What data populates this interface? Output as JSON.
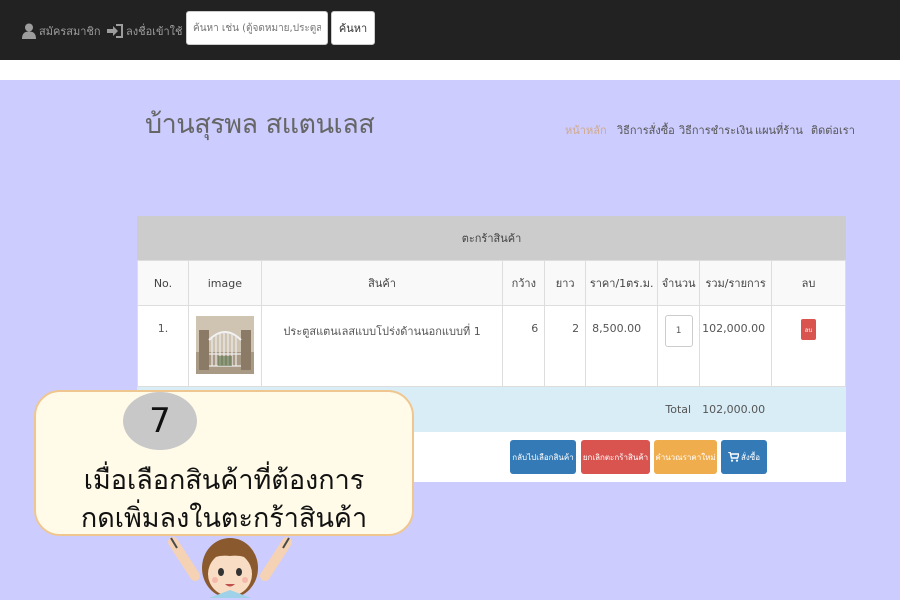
{
  "topbar": {
    "register_label": "สมัครสมาชิก",
    "login_label": "ลงชื่อเข้าใช้",
    "search_placeholder": "ค้นหา เช่น (ตู้จดหมาย,ประตูสแตนเลส)",
    "search_button": "ค้นหา"
  },
  "brand": "บ้านสุรพล สแตนเลส",
  "nav": [
    {
      "label": "หน้าหลัก",
      "active": true
    },
    {
      "label": "วิธีการสั่งซื้อ",
      "active": false
    },
    {
      "label": "วิธีการชำระเงิน",
      "active": false
    },
    {
      "label": "แผนที่ร้าน",
      "active": false
    },
    {
      "label": "ติดต่อเรา",
      "active": false
    }
  ],
  "cart": {
    "title": "ตะกร้าสินค้า",
    "headers": [
      "No.",
      "image",
      "สินค้า",
      "กว้าง",
      "ยาว",
      "ราคา/1ตร.ม.",
      "จำนวน",
      "รวม/รายการ",
      "ลบ"
    ],
    "items": [
      {
        "no": "1.",
        "name": "ประตูสแตนเลสแบบโปร่งด้านนอกแบบที่ 1",
        "width": "6",
        "length": "2",
        "price": "8,500.00",
        "qty": "1",
        "subtotal": "102,000.00",
        "delete_label": "ลบ"
      }
    ],
    "total_label": "Total",
    "total_value": "102,000.00",
    "buttons": {
      "continue": "กลับไปเลือกสินค้า",
      "cancel": "ยกเลิกตะกร้าสินค้า",
      "recalc": "คำนวณราคาใหม่",
      "order": "สั่งซื้อ"
    }
  },
  "callout": {
    "step": "7",
    "line1": "เมื่อเลือกสินค้าที่ต้องการ",
    "line2": "กดเพิ่มลงในตะกร้าสินค้า"
  },
  "colors": {
    "background": "#ccccfe",
    "navbar": "#222222",
    "btn_continue": "#337ab7",
    "btn_cancel": "#d9534f",
    "btn_recalc": "#f0ad4e",
    "btn_order": "#337ab7",
    "total_row": "#d9edf7"
  }
}
